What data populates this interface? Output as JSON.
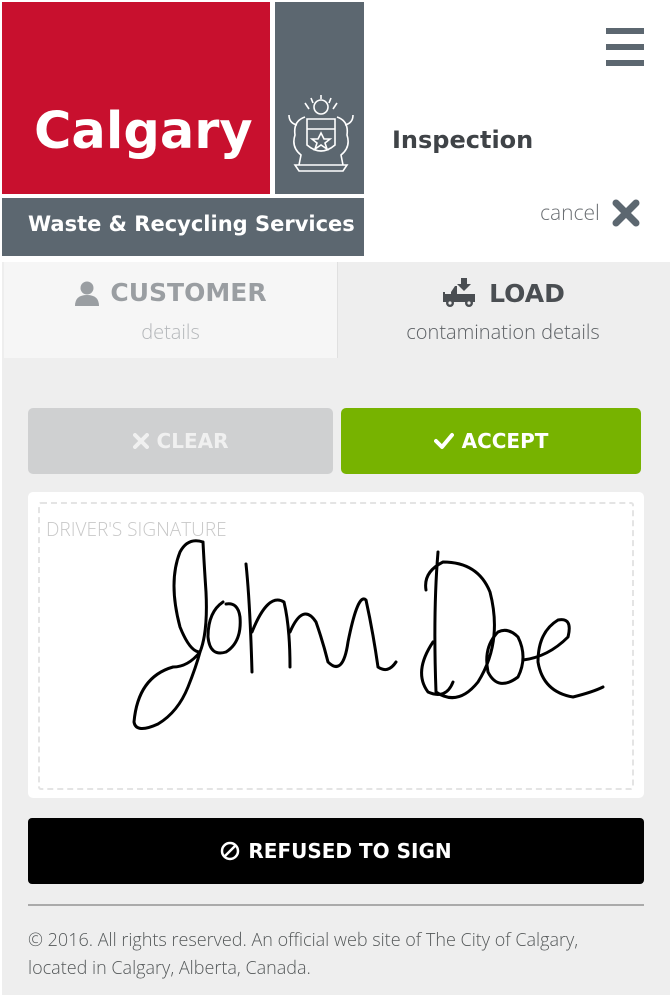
{
  "header": {
    "logo_word": "Calgary",
    "logo_subtitle": "Waste & Recycling Services",
    "page_title": "Inspection",
    "cancel_label": "cancel"
  },
  "tabs": [
    {
      "label": "CUSTOMER",
      "sub": "details",
      "icon": "user-icon",
      "active": false
    },
    {
      "label": "LOAD",
      "sub": "contamination details",
      "icon": "truck-load-icon",
      "active": true
    }
  ],
  "signature": {
    "clear_label": "CLEAR",
    "accept_label": "ACCEPT",
    "field_label": "DRIVER'S SIGNATURE",
    "refused_label": "REFUSED TO SIGN"
  },
  "footer": {
    "copyright": "© 2016. All rights reserved. An official web site of The City of Calgary, located in Calgary, Alberta, Canada."
  },
  "colors": {
    "brand_red": "#c8102e",
    "brand_grey": "#5c6770",
    "accept_green": "#77b300",
    "clear_grey": "#cfd0d1",
    "panel_bg": "#eeeeee"
  }
}
